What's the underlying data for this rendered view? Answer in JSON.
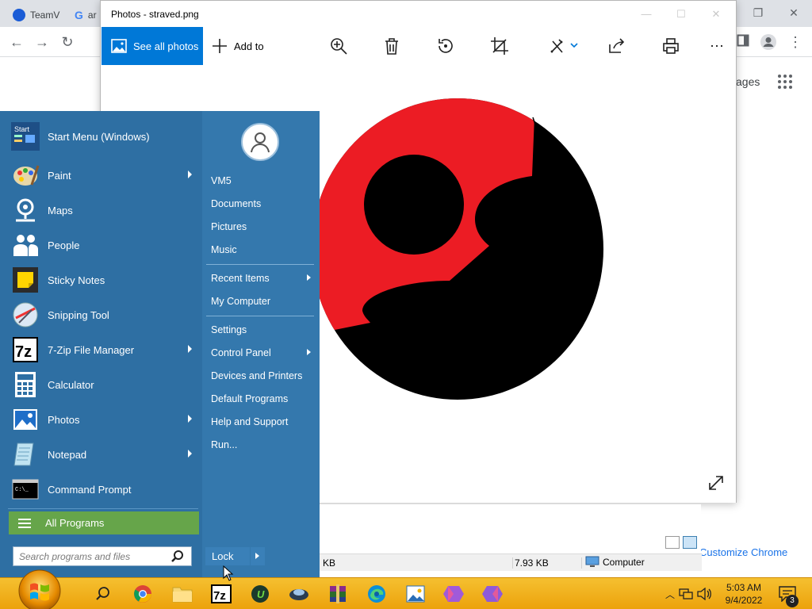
{
  "chrome": {
    "tabs": [
      {
        "label": "TeamV"
      },
      {
        "label": "ar"
      }
    ],
    "images_link": "ages",
    "customize_label": "Customize Chrome"
  },
  "photos": {
    "title": "Photos - straved.png",
    "toolbar": {
      "see_all_label": "See all photos",
      "add_to_label": "Add to",
      "tools": [
        "zoom-in-icon",
        "delete-icon",
        "rotate-icon",
        "crop-icon",
        "edit-icon",
        "share-icon",
        "print-icon",
        "more-icon"
      ]
    },
    "image": {
      "colors": {
        "red": "#ec1c24",
        "black": "#000000"
      }
    }
  },
  "statusbar": {
    "left_size": "KB",
    "right_size": "7.93 KB",
    "location": "Computer"
  },
  "startmenu": {
    "pinned": [
      {
        "label": "Start Menu (Windows)",
        "icon": "start-menu-icon",
        "has_submenu": false
      },
      {
        "label": "Paint",
        "icon": "paint-icon",
        "has_submenu": true
      },
      {
        "label": "Maps",
        "icon": "maps-icon",
        "has_submenu": false
      },
      {
        "label": "People",
        "icon": "people-icon",
        "has_submenu": false
      },
      {
        "label": "Sticky Notes",
        "icon": "sticky-notes-icon",
        "has_submenu": false
      },
      {
        "label": "Snipping Tool",
        "icon": "snipping-tool-icon",
        "has_submenu": false
      },
      {
        "label": "7-Zip File Manager",
        "icon": "seven-zip-icon",
        "has_submenu": true
      },
      {
        "label": "Calculator",
        "icon": "calculator-icon",
        "has_submenu": false
      },
      {
        "label": "Photos",
        "icon": "photos-icon",
        "has_submenu": true
      },
      {
        "label": "Notepad",
        "icon": "notepad-icon",
        "has_submenu": true
      },
      {
        "label": "Command Prompt",
        "icon": "command-prompt-icon",
        "has_submenu": false
      }
    ],
    "all_programs_label": "All Programs",
    "search_placeholder": "Search programs and files",
    "right": {
      "user": "VM5",
      "group1": [
        {
          "label": "Documents"
        },
        {
          "label": "Pictures"
        },
        {
          "label": "Music"
        }
      ],
      "group2": [
        {
          "label": "Recent Items",
          "has_submenu": true
        },
        {
          "label": "My Computer",
          "has_submenu": false
        }
      ],
      "group3": [
        {
          "label": "Settings",
          "has_submenu": false
        },
        {
          "label": "Control Panel",
          "has_submenu": true
        },
        {
          "label": "Devices and Printers",
          "has_submenu": false
        },
        {
          "label": "Default Programs",
          "has_submenu": false
        },
        {
          "label": "Help and Support",
          "has_submenu": false
        },
        {
          "label": "Run...",
          "has_submenu": false
        }
      ]
    },
    "lock_label": "Lock",
    "start_orb_icon": "start-orb-icon"
  },
  "taskbar": {
    "apps": [
      "search-icon",
      "chrome-icon",
      "file-explorer-icon",
      "seven-zip-icon",
      "upwork-icon",
      "vpn-icon",
      "winrar-icon",
      "edge-icon",
      "photos-icon",
      "app-icon-1",
      "app-icon-2"
    ],
    "clock_time": "5:03 AM",
    "clock_date": "9/4/2022",
    "notification_count": "3",
    "accent": "#eca20c"
  }
}
